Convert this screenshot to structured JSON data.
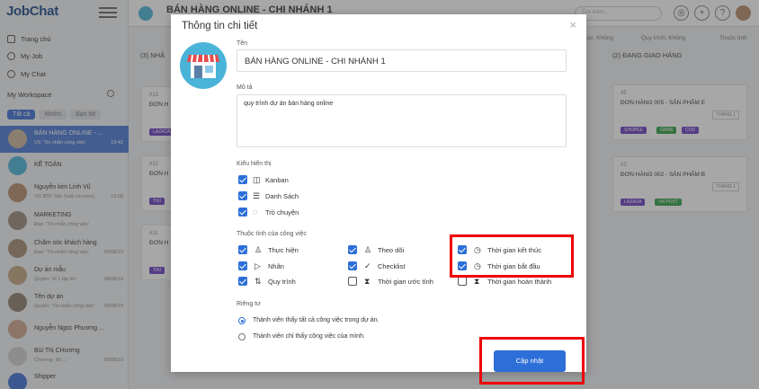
{
  "app": {
    "logo": "JobChat"
  },
  "sidebar": {
    "nav": [
      {
        "label": "Trang chủ",
        "icon": "home-icon"
      },
      {
        "label": "My Job",
        "icon": "person-icon"
      },
      {
        "label": "My Chat",
        "icon": "chat-icon"
      }
    ],
    "workspace_title": "My Workspace",
    "filters": [
      "Tất cả",
      "Nhóm",
      "Bạn bè"
    ],
    "chats": [
      {
        "name": "BÁN HÀNG ONLINE - ...",
        "sub": "Vũ: 'Tin nhắn công việc'",
        "time": "19:42",
        "active": true
      },
      {
        "name": "KẾ TOÁN",
        "sub": "",
        "time": ""
      },
      {
        "name": "Nguyễn kim Linh Vũ",
        "sub": "VG BSF Sản Xuất xin sorry...",
        "time": "19:08"
      },
      {
        "name": "MARKETING",
        "sub": "Đạo: 'Tin nhắn công việc'",
        "time": ""
      },
      {
        "name": "Chăm sóc khách hàng",
        "sub": "Đạo: 'Tin nhắn công việc'",
        "time": "09/08/19"
      },
      {
        "name": "Dự án mẫu",
        "sub": "Quyền: 'đi 1 tập tin'",
        "time": "08/08/19"
      },
      {
        "name": "Tên dự án",
        "sub": "Quyền: 'Tin nhắn công việc'",
        "time": "06/08/19"
      },
      {
        "name": "Nguyễn Ngọc Phương ...",
        "sub": "",
        "time": ""
      },
      {
        "name": "Bùi Thị CHương",
        "sub": "Chương: 'Đi ...'",
        "time": "05/08/19"
      },
      {
        "name": "Shipper",
        "sub": "",
        "time": ""
      }
    ]
  },
  "topbar": {
    "project": "BÁN HÀNG ONLINE - CHI NHÁNH 1",
    "search_placeholder": "Tìm kiếm..."
  },
  "board": {
    "tools": {
      "filter": "Lọc: Không",
      "assignee": "Quy trình: Không",
      "sort": "Thuộc tính"
    },
    "columns": [
      {
        "title": "(3) NHẬ"
      },
      {
        "title": "(2) ĐANG GIAO HÀNG"
      }
    ],
    "left_cards": [
      {
        "num": "#13",
        "title": "ĐƠN H",
        "tag": "LAZADA"
      },
      {
        "num": "#12",
        "title": "ĐƠN H",
        "tag": "TIKI"
      },
      {
        "num": "#11",
        "title": "ĐƠN H",
        "tag": "TIKI"
      }
    ],
    "right_cards": [
      {
        "num": "#5",
        "title": "ĐƠN HÀNG 005 - SẢN PHẨM E",
        "month": "THÁNG 1",
        "tags": [
          "SHOPEE",
          "GRAB",
          "COD"
        ]
      },
      {
        "num": "#2",
        "title": "ĐƠN HÀNG 002 - SẢN PHẨM B",
        "month": "THÁNG 1",
        "tags": [
          "LAZADA",
          "VN POST"
        ]
      }
    ],
    "tag_colors": {
      "LAZADA": "#6a3fc4",
      "TIKI": "#6a3fc4",
      "SHOPEE": "#6a3fc4",
      "GRAB": "#2e9e44",
      "COD": "#6a3fc4",
      "VN POST": "#2e9e44"
    }
  },
  "modal": {
    "title": "Thông tin chi tiết",
    "name_label": "Tên",
    "name_value": "BÁN HÀNG ONLINE - CHI NHÁNH 1",
    "desc_label": "Mô tả",
    "desc_value": "quy trình dự án bán hàng online",
    "display_label": "Kiểu hiển thị",
    "display_options": [
      {
        "label": "Kanban",
        "icon": "kanban-icon",
        "checked": true
      },
      {
        "label": "Danh Sách",
        "icon": "list-icon",
        "checked": true
      },
      {
        "label": "Trò chuyện",
        "icon": "chat-bubble-icon",
        "checked": true
      }
    ],
    "attr_label": "Thuộc tính của công việc",
    "attributes": [
      {
        "label": "Thực hiện",
        "icon": "assignee-icon",
        "checked": true
      },
      {
        "label": "Theo dõi",
        "icon": "follower-icon",
        "checked": true
      },
      {
        "label": "Thời gian kết thúc",
        "icon": "clock-icon",
        "checked": true
      },
      {
        "label": "Nhãn",
        "icon": "label-icon",
        "checked": true
      },
      {
        "label": "Checklist",
        "icon": "checklist-icon",
        "checked": true
      },
      {
        "label": "Thời gian bắt đầu",
        "icon": "clock-icon",
        "checked": true
      },
      {
        "label": "Quy trình",
        "icon": "workflow-icon",
        "checked": true
      },
      {
        "label": "Thời gian ước tính",
        "icon": "hourglass-icon",
        "checked": false
      },
      {
        "label": "Thời gian hoàn thành",
        "icon": "hourglass-icon",
        "checked": false
      }
    ],
    "privacy_label": "Riêng tư",
    "privacy_options": [
      {
        "label": "Thành viên thấy tất cả công việc trong dự án.",
        "selected": true
      },
      {
        "label": "Thành viên chỉ thấy công việc của mình.",
        "selected": false
      }
    ],
    "update_label": "Cập nhật"
  },
  "colors": {
    "primary": "#2d6fd8",
    "highlight": "#e00000",
    "logo": "#1a4a8a"
  }
}
